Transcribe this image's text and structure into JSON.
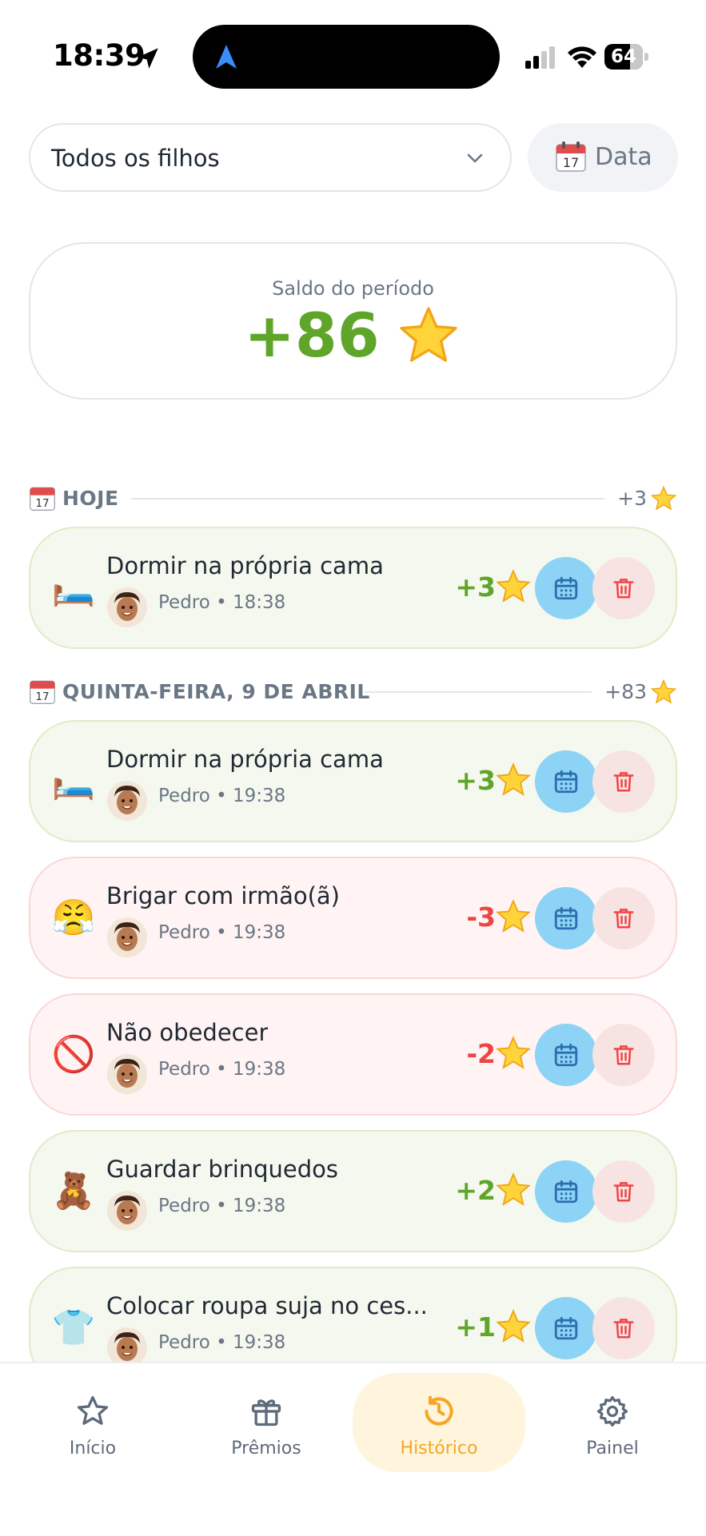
{
  "status": {
    "time": "18:39",
    "battery": "64"
  },
  "filter": {
    "child_select": "Todos os filhos",
    "date_button": "Data"
  },
  "balance": {
    "label": "Saldo do período",
    "value": "+86"
  },
  "sections": [
    {
      "title": "HOJE",
      "total": "+3",
      "entries": [
        {
          "emoji": "🛏️",
          "name": "Dormir na própria cama",
          "child": "Pedro",
          "time": "18:38",
          "meta": "Pedro • 18:38",
          "points": "+3",
          "kind": "pos"
        }
      ]
    },
    {
      "title": "QUINTA-FEIRA, 9 DE ABRIL",
      "total": "+83",
      "entries": [
        {
          "emoji": "🛏️",
          "name": "Dormir na própria cama",
          "child": "Pedro",
          "time": "19:38",
          "meta": "Pedro • 19:38",
          "points": "+3",
          "kind": "pos"
        },
        {
          "emoji": "😤",
          "name": "Brigar com irmão(ã)",
          "child": "Pedro",
          "time": "19:38",
          "meta": "Pedro • 19:38",
          "points": "-3",
          "kind": "neg"
        },
        {
          "emoji": "🚫",
          "name": "Não obedecer",
          "child": "Pedro",
          "time": "19:38",
          "meta": "Pedro • 19:38",
          "points": "-2",
          "kind": "neg"
        },
        {
          "emoji": "🧸",
          "name": "Guardar brinquedos",
          "child": "Pedro",
          "time": "19:38",
          "meta": "Pedro • 19:38",
          "points": "+2",
          "kind": "pos"
        },
        {
          "emoji": "👕",
          "name": "Colocar roupa suja no ces...",
          "child": "Pedro",
          "time": "19:38",
          "meta": "Pedro • 19:38",
          "points": "+1",
          "kind": "pos"
        }
      ]
    }
  ],
  "tabs": [
    {
      "label": "Início",
      "icon": "star-icon"
    },
    {
      "label": "Prêmios",
      "icon": "gift-icon"
    },
    {
      "label": "Histórico",
      "icon": "history-icon",
      "active": true
    },
    {
      "label": "Painel",
      "icon": "gear-icon"
    }
  ],
  "colors": {
    "positive": "#5fa52a",
    "negative": "#ef4444",
    "accent": "#f5a623",
    "calendar_button": "#8dd3f5"
  }
}
